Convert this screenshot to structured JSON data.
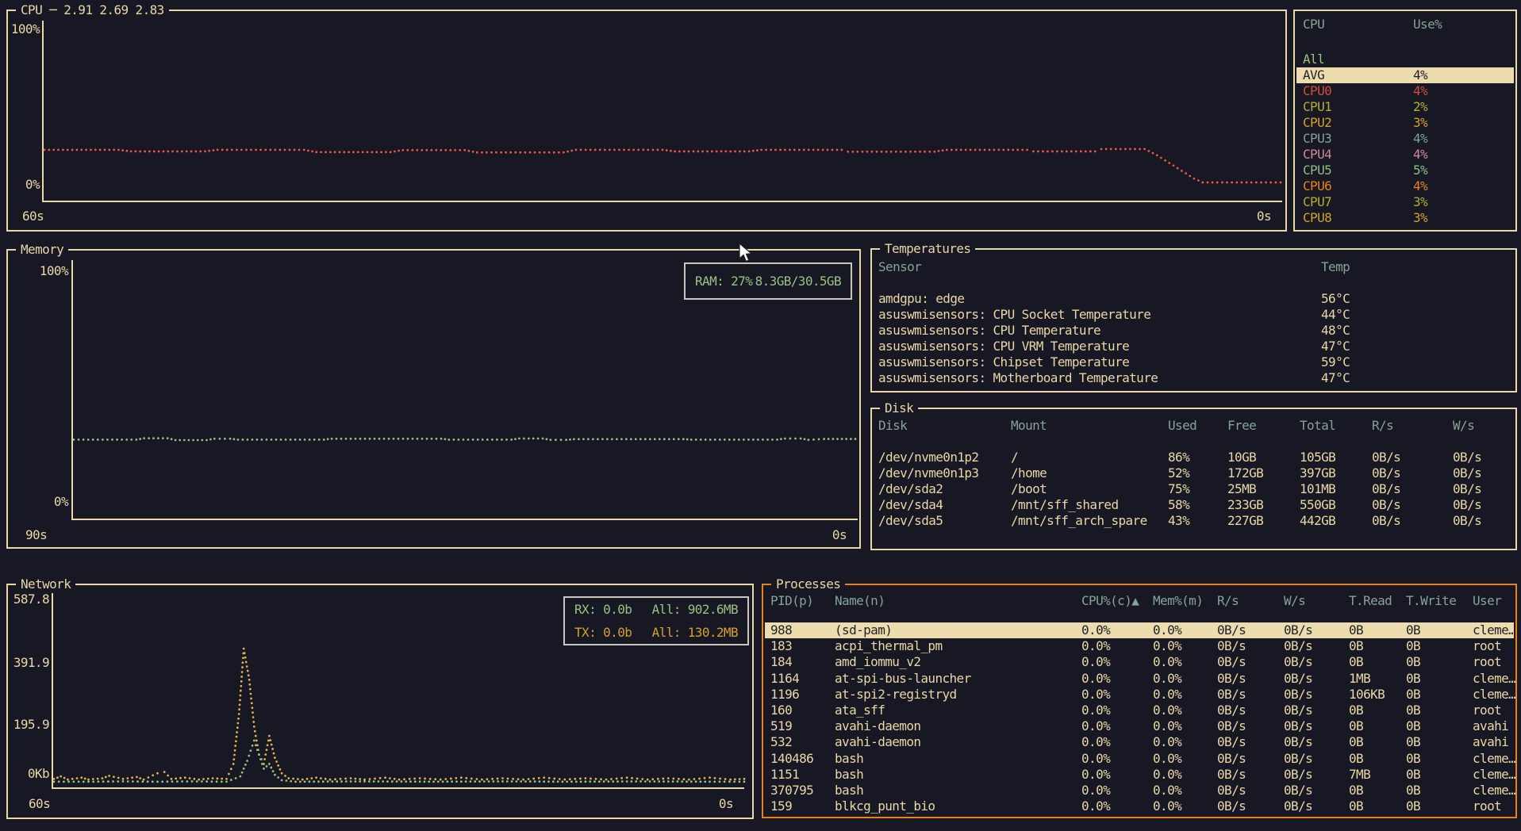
{
  "colors": {
    "background": "#171823",
    "foreground": "#e9d7a7",
    "table_header": "#87a296",
    "green": "#99c184",
    "gold": "#d6a02c",
    "orange": "#e8821e",
    "red_line": "#f2564d",
    "highlight_bg": "#ecdcae",
    "highlight_fg": "#21222a",
    "badge_border": "#c9c7c0"
  },
  "cpu": {
    "title": "CPU",
    "separator": " ─ ",
    "load_average": "2.91 2.69 2.83",
    "y_labels": [
      "100%",
      "0%"
    ],
    "x_labels": [
      "60s",
      "0s"
    ],
    "series_color": "#f2564d",
    "series": [
      [
        0,
        22.5
      ],
      [
        0.06,
        22.5
      ],
      [
        0.07,
        21.5
      ],
      [
        0.13,
        21.5
      ],
      [
        0.14,
        22.5
      ],
      [
        0.21,
        22.5
      ],
      [
        0.22,
        21
      ],
      [
        0.28,
        21
      ],
      [
        0.29,
        22.3
      ],
      [
        0.34,
        22.3
      ],
      [
        0.35,
        20.8
      ],
      [
        0.42,
        20.8
      ],
      [
        0.43,
        22.5
      ],
      [
        0.5,
        22.5
      ],
      [
        0.51,
        21.5
      ],
      [
        0.57,
        21.5
      ],
      [
        0.58,
        22.5
      ],
      [
        0.645,
        22.5
      ],
      [
        0.65,
        21.3
      ],
      [
        0.72,
        21.3
      ],
      [
        0.73,
        22.5
      ],
      [
        0.795,
        22.5
      ],
      [
        0.8,
        21.5
      ],
      [
        0.85,
        21.5
      ],
      [
        0.855,
        23
      ],
      [
        0.89,
        23
      ],
      [
        0.9,
        19
      ],
      [
        0.91,
        14
      ],
      [
        0.92,
        9
      ],
      [
        0.93,
        4
      ],
      [
        0.937,
        1.5
      ],
      [
        1,
        1.5
      ]
    ]
  },
  "cpu_legend": {
    "headers": [
      "CPU",
      "Use%"
    ],
    "rows": [
      {
        "name": "All",
        "value": "",
        "color": "#99c184",
        "highlight": false
      },
      {
        "name": "AVG",
        "value": "4%",
        "color": "#21222a",
        "highlight": true
      },
      {
        "name": "CPU0",
        "value": "4%",
        "color": "#d14b42",
        "highlight": false
      },
      {
        "name": "CPU1",
        "value": "2%",
        "color": "#b3af2f",
        "highlight": false
      },
      {
        "name": "CPU2",
        "value": "3%",
        "color": "#d6a02c",
        "highlight": false
      },
      {
        "name": "CPU3",
        "value": "4%",
        "color": "#7fa491",
        "highlight": false
      },
      {
        "name": "CPU4",
        "value": "4%",
        "color": "#cf8799",
        "highlight": false
      },
      {
        "name": "CPU5",
        "value": "5%",
        "color": "#93bd80",
        "highlight": false
      },
      {
        "name": "CPU6",
        "value": "4%",
        "color": "#e8821e",
        "highlight": false
      },
      {
        "name": "CPU7",
        "value": "3%",
        "color": "#b3af2f",
        "highlight": false
      },
      {
        "name": "CPU8",
        "value": "3%",
        "color": "#d6a02c",
        "highlight": false
      }
    ]
  },
  "memory": {
    "title": "Memory",
    "y_labels": [
      "100%",
      "0%"
    ],
    "x_labels": [
      "90s",
      "0s"
    ],
    "badge_text": "RAM: 27%",
    "badge_value": "8.3GB/30.5GB",
    "series_color": "#99c184",
    "series": [
      [
        0,
        27
      ],
      [
        0.08,
        27
      ],
      [
        0.09,
        27.6
      ],
      [
        0.12,
        27.6
      ],
      [
        0.13,
        26.8
      ],
      [
        0.17,
        26.8
      ],
      [
        0.18,
        27.4
      ],
      [
        0.2,
        27.4
      ],
      [
        0.21,
        27
      ],
      [
        0.32,
        27
      ],
      [
        0.33,
        27.4
      ],
      [
        0.47,
        27.4
      ],
      [
        0.48,
        27
      ],
      [
        0.56,
        27
      ],
      [
        0.57,
        27.5
      ],
      [
        0.6,
        27.5
      ],
      [
        0.61,
        26.9
      ],
      [
        0.63,
        26.9
      ],
      [
        0.64,
        27.2
      ],
      [
        0.78,
        27.2
      ],
      [
        0.79,
        27
      ],
      [
        0.9,
        27
      ],
      [
        0.91,
        27.5
      ],
      [
        0.93,
        27.5
      ],
      [
        0.94,
        26.9
      ],
      [
        0.96,
        27.3
      ],
      [
        1,
        27.3
      ]
    ]
  },
  "temperatures": {
    "title": "Temperatures",
    "headers": [
      "Sensor",
      "Temp"
    ],
    "rows": [
      [
        "amdgpu: edge",
        "56°C"
      ],
      [
        "asuswmisensors: CPU Socket Temperature",
        "44°C"
      ],
      [
        "asuswmisensors: CPU Temperature",
        "48°C"
      ],
      [
        "asuswmisensors: CPU VRM Temperature",
        "47°C"
      ],
      [
        "asuswmisensors: Chipset Temperature",
        "59°C"
      ],
      [
        "asuswmisensors: Motherboard Temperature",
        "47°C"
      ]
    ]
  },
  "disk": {
    "title": "Disk",
    "headers": [
      "Disk",
      "Mount",
      "Used",
      "Free",
      "Total",
      "R/s",
      "W/s"
    ],
    "rows": [
      [
        "/dev/nvme0n1p2",
        "/",
        "86%",
        "10GB",
        "105GB",
        "0B/s",
        "0B/s"
      ],
      [
        "/dev/nvme0n1p3",
        "/home",
        "52%",
        "172GB",
        "397GB",
        "0B/s",
        "0B/s"
      ],
      [
        "/dev/sda2",
        "/boot",
        "75%",
        "25MB",
        "101MB",
        "0B/s",
        "0B/s"
      ],
      [
        "/dev/sda4",
        "/mnt/sff_shared",
        "58%",
        "233GB",
        "550GB",
        "0B/s",
        "0B/s"
      ],
      [
        "/dev/sda5",
        "/mnt/sff_arch_spare",
        "43%",
        "227GB",
        "442GB",
        "0B/s",
        "0B/s"
      ]
    ]
  },
  "network": {
    "title": "Network",
    "y_labels": [
      "587.8",
      "391.9",
      "195.9",
      "0Kb"
    ],
    "x_labels": [
      "60s",
      "0s"
    ],
    "badge": {
      "rx_label": "RX: 0.0b",
      "rx_all": "All: 902.6MB",
      "tx_label": "TX: 0.0b",
      "tx_all": "All: 130.2MB"
    },
    "tx_color": "#e5b54a",
    "rx_color": "#99c184",
    "tx_series": [
      [
        0,
        12
      ],
      [
        0.01,
        20
      ],
      [
        0.02,
        10
      ],
      [
        0.04,
        16
      ],
      [
        0.05,
        10
      ],
      [
        0.07,
        14
      ],
      [
        0.08,
        22
      ],
      [
        0.1,
        12
      ],
      [
        0.12,
        18
      ],
      [
        0.13,
        10
      ],
      [
        0.15,
        30
      ],
      [
        0.16,
        34
      ],
      [
        0.17,
        12
      ],
      [
        0.19,
        16
      ],
      [
        0.21,
        10
      ],
      [
        0.23,
        14
      ],
      [
        0.25,
        12
      ],
      [
        0.26,
        60
      ],
      [
        0.268,
        220
      ],
      [
        0.275,
        430
      ],
      [
        0.283,
        330
      ],
      [
        0.29,
        180
      ],
      [
        0.297,
        90
      ],
      [
        0.304,
        60
      ],
      [
        0.312,
        150
      ],
      [
        0.32,
        80
      ],
      [
        0.33,
        30
      ],
      [
        0.34,
        14
      ],
      [
        0.36,
        10
      ],
      [
        0.38,
        16
      ],
      [
        0.4,
        10
      ],
      [
        0.43,
        14
      ],
      [
        0.45,
        10
      ],
      [
        0.48,
        16
      ],
      [
        0.5,
        10
      ],
      [
        0.53,
        14
      ],
      [
        0.56,
        10
      ],
      [
        0.59,
        16
      ],
      [
        0.62,
        10
      ],
      [
        0.65,
        14
      ],
      [
        0.68,
        10
      ],
      [
        0.71,
        16
      ],
      [
        0.74,
        10
      ],
      [
        0.77,
        14
      ],
      [
        0.8,
        10
      ],
      [
        0.83,
        16
      ],
      [
        0.86,
        10
      ],
      [
        0.89,
        14
      ],
      [
        0.92,
        10
      ],
      [
        0.95,
        16
      ],
      [
        0.98,
        10
      ],
      [
        1,
        12
      ]
    ],
    "rx_series": [
      [
        0,
        3
      ],
      [
        0.05,
        3
      ],
      [
        0.1,
        4
      ],
      [
        0.15,
        3
      ],
      [
        0.2,
        4
      ],
      [
        0.25,
        3
      ],
      [
        0.27,
        20
      ],
      [
        0.28,
        70
      ],
      [
        0.29,
        135
      ],
      [
        0.297,
        90
      ],
      [
        0.304,
        45
      ],
      [
        0.312,
        60
      ],
      [
        0.32,
        25
      ],
      [
        0.33,
        8
      ],
      [
        0.35,
        3
      ],
      [
        0.45,
        4
      ],
      [
        0.55,
        3
      ],
      [
        0.65,
        4
      ],
      [
        0.75,
        3
      ],
      [
        0.85,
        4
      ],
      [
        0.95,
        3
      ],
      [
        1,
        3
      ]
    ]
  },
  "processes": {
    "title": "Processes",
    "headers": [
      "PID(p)",
      "Name(n)",
      "CPU%(c)▲",
      "Mem%(m)",
      "R/s",
      "W/s",
      "T.Read",
      "T.Write",
      "User"
    ],
    "rows": [
      {
        "cells": [
          "988",
          "(sd-pam)",
          "0.0%",
          "0.0%",
          "0B/s",
          "0B/s",
          "0B",
          "0B",
          "cleme…"
        ],
        "highlight": true
      },
      {
        "cells": [
          "183",
          "acpi_thermal_pm",
          "0.0%",
          "0.0%",
          "0B/s",
          "0B/s",
          "0B",
          "0B",
          "root"
        ],
        "highlight": false
      },
      {
        "cells": [
          "184",
          "amd_iommu_v2",
          "0.0%",
          "0.0%",
          "0B/s",
          "0B/s",
          "0B",
          "0B",
          "root"
        ],
        "highlight": false
      },
      {
        "cells": [
          "1164",
          "at-spi-bus-launcher",
          "0.0%",
          "0.0%",
          "0B/s",
          "0B/s",
          "1MB",
          "0B",
          "cleme…"
        ],
        "highlight": false
      },
      {
        "cells": [
          "1196",
          "at-spi2-registryd",
          "0.0%",
          "0.0%",
          "0B/s",
          "0B/s",
          "106KB",
          "0B",
          "cleme…"
        ],
        "highlight": false
      },
      {
        "cells": [
          "160",
          "ata_sff",
          "0.0%",
          "0.0%",
          "0B/s",
          "0B/s",
          "0B",
          "0B",
          "root"
        ],
        "highlight": false
      },
      {
        "cells": [
          "519",
          "avahi-daemon",
          "0.0%",
          "0.0%",
          "0B/s",
          "0B/s",
          "0B",
          "0B",
          "avahi"
        ],
        "highlight": false
      },
      {
        "cells": [
          "532",
          "avahi-daemon",
          "0.0%",
          "0.0%",
          "0B/s",
          "0B/s",
          "0B",
          "0B",
          "avahi"
        ],
        "highlight": false
      },
      {
        "cells": [
          "140486",
          "bash",
          "0.0%",
          "0.0%",
          "0B/s",
          "0B/s",
          "0B",
          "0B",
          "cleme…"
        ],
        "highlight": false
      },
      {
        "cells": [
          "1151",
          "bash",
          "0.0%",
          "0.0%",
          "0B/s",
          "0B/s",
          "7MB",
          "0B",
          "cleme…"
        ],
        "highlight": false
      },
      {
        "cells": [
          "370795",
          "bash",
          "0.0%",
          "0.0%",
          "0B/s",
          "0B/s",
          "0B",
          "0B",
          "cleme…"
        ],
        "highlight": false
      },
      {
        "cells": [
          "159",
          "blkcg_punt_bio",
          "0.0%",
          "0.0%",
          "0B/s",
          "0B/s",
          "0B",
          "0B",
          "root"
        ],
        "highlight": false
      }
    ]
  }
}
